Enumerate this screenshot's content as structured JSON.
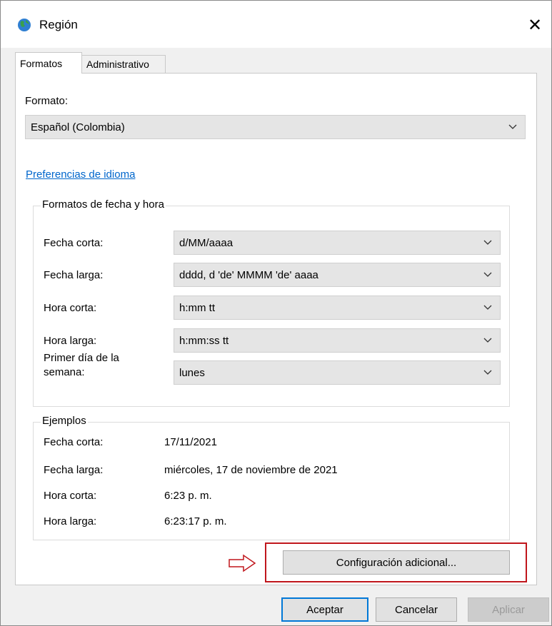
{
  "window": {
    "title": "Región",
    "close_glyph": "✕"
  },
  "tabs": [
    {
      "label": "Formatos",
      "active": true
    },
    {
      "label": "Administrativo",
      "active": false
    }
  ],
  "format": {
    "label": "Formato:",
    "value": "Español (Colombia)"
  },
  "language_link": "Preferencias de idioma",
  "datetime": {
    "group_title": "Formatos de fecha y hora",
    "rows": [
      {
        "label": "Fecha corta:",
        "value": "d/MM/aaaa"
      },
      {
        "label": "Fecha larga:",
        "value": "dddd, d 'de' MMMM 'de' aaaa"
      },
      {
        "label": "Hora corta:",
        "value": "h:mm tt"
      },
      {
        "label": "Hora larga:",
        "value": "h:mm:ss tt"
      },
      {
        "label": "Primer día de la semana:",
        "value": "lunes"
      }
    ]
  },
  "examples": {
    "group_title": "Ejemplos",
    "rows": [
      {
        "label": "Fecha corta:",
        "value": "17/11/2021"
      },
      {
        "label": "Fecha larga:",
        "value": "miércoles, 17 de noviembre de 2021"
      },
      {
        "label": "Hora corta:",
        "value": "6:23 p. m."
      },
      {
        "label": "Hora larga:",
        "value": "6:23:17 p. m."
      }
    ]
  },
  "buttons": {
    "additional": "Configuración adicional...",
    "ok": "Aceptar",
    "cancel": "Cancelar",
    "apply": "Aplicar"
  },
  "icons": {
    "title": "globe-icon",
    "combo": "chevron-down-icon",
    "pointer": "right-arrow-icon"
  },
  "colors": {
    "link": "#0066cc",
    "highlight": "#c0161c",
    "default_button_border": "#0078d7"
  }
}
